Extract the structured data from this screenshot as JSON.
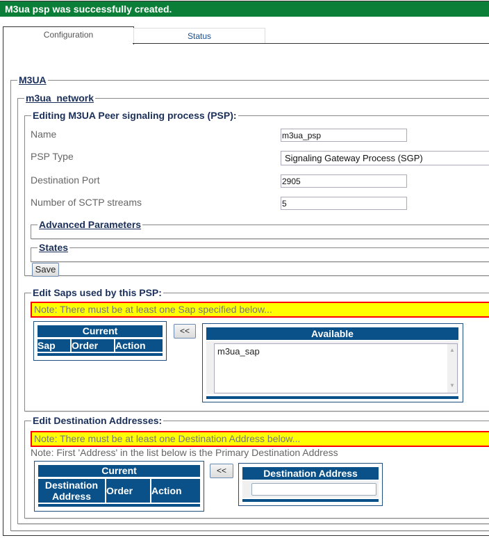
{
  "banner": {
    "message": "M3ua psp was successfully created.",
    "color": "#0b7f37"
  },
  "tabs": [
    {
      "label": "Configuration",
      "active": true
    },
    {
      "label": "Status",
      "active": false
    }
  ],
  "sections": {
    "m3ua": "M3UA",
    "network": "m3ua_network",
    "editing": "Editing M3UA Peer signaling process (PSP):"
  },
  "form": {
    "name_label": "Name",
    "name_value": "m3ua_psp",
    "psp_type_label": "PSP Type",
    "psp_type_value": "Signaling Gateway Process (SGP)",
    "dest_port_label": "Destination Port",
    "dest_port_value": "2905",
    "sctp_label": "Number of SCTP streams",
    "sctp_value": "5",
    "advanced": "Advanced Parameters",
    "states": "States",
    "save": "Save"
  },
  "saps": {
    "title": "Edit Saps used by this PSP:",
    "note": "Note: There must be at least one Sap specified below...",
    "current_header": "Current",
    "columns": [
      "Sap",
      "Order",
      "Action"
    ],
    "move_button": "<<",
    "available_header": "Available",
    "available_items": [
      "m3ua_sap"
    ]
  },
  "dest": {
    "title": "Edit Destination Addresses:",
    "note": "Note: There must be at least one Destination Address below...",
    "note2": "Note: First 'Address' in the list below is the Primary Destination Address",
    "current_header": "Current",
    "columns": [
      "Destination Address",
      "Order",
      "Action"
    ],
    "move_button": "<<",
    "address_header": "Destination Address",
    "address_value": ""
  }
}
